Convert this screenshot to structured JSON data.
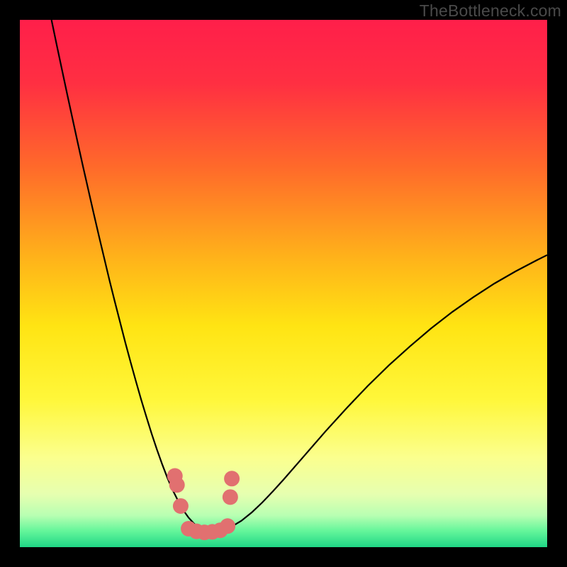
{
  "watermark": "TheBottleneck.com",
  "chart_data": {
    "type": "line",
    "title": "",
    "xlabel": "",
    "ylabel": "",
    "xlim": [
      0,
      100
    ],
    "ylim": [
      0,
      100
    ],
    "background_gradient": {
      "stops": [
        {
          "offset": 0.0,
          "color": "#ff1f4a"
        },
        {
          "offset": 0.12,
          "color": "#ff2f42"
        },
        {
          "offset": 0.28,
          "color": "#ff6a2a"
        },
        {
          "offset": 0.45,
          "color": "#ffb21a"
        },
        {
          "offset": 0.58,
          "color": "#ffe413"
        },
        {
          "offset": 0.72,
          "color": "#fff73a"
        },
        {
          "offset": 0.83,
          "color": "#fbff8e"
        },
        {
          "offset": 0.9,
          "color": "#e6ffb0"
        },
        {
          "offset": 0.94,
          "color": "#b8ffb2"
        },
        {
          "offset": 0.97,
          "color": "#62f59a"
        },
        {
          "offset": 1.0,
          "color": "#1fd786"
        }
      ]
    },
    "series": [
      {
        "name": "curve",
        "stroke": "#000000",
        "stroke_width": 2.2,
        "x": [
          6,
          7,
          8,
          9,
          10,
          11,
          12,
          13,
          14,
          15,
          16,
          17,
          18,
          19,
          20,
          21,
          22,
          23,
          24,
          25,
          26,
          27,
          28,
          29,
          30,
          31,
          32,
          33,
          34,
          35,
          36,
          38,
          40,
          42,
          44,
          46,
          48,
          50,
          54,
          58,
          62,
          66,
          70,
          74,
          78,
          82,
          86,
          90,
          94,
          98,
          100
        ],
        "y": [
          100,
          95.2,
          90.5,
          85.8,
          81.2,
          76.6,
          72.1,
          67.7,
          63.3,
          59.0,
          54.8,
          50.6,
          46.6,
          42.7,
          38.8,
          35.1,
          31.5,
          28.0,
          24.7,
          21.5,
          18.5,
          15.7,
          13.1,
          10.8,
          8.8,
          7.0,
          5.6,
          4.5,
          3.6,
          3.1,
          2.9,
          3.1,
          3.8,
          5.0,
          6.6,
          8.5,
          10.6,
          12.8,
          17.4,
          22.0,
          26.4,
          30.6,
          34.5,
          38.1,
          41.5,
          44.6,
          47.4,
          50.0,
          52.3,
          54.4,
          55.4
        ]
      },
      {
        "name": "valley-marker",
        "type": "scatter",
        "stroke": "#e17070",
        "fill": "#e17070",
        "radius": 11,
        "x": [
          29.4,
          29.8,
          30.5,
          32.0,
          33.5,
          35.0,
          36.5,
          38.0,
          39.4,
          39.9,
          40.2
        ],
        "y": [
          13.5,
          11.8,
          7.8,
          3.5,
          3.0,
          2.8,
          2.9,
          3.2,
          4.0,
          9.5,
          13.0
        ]
      }
    ]
  }
}
